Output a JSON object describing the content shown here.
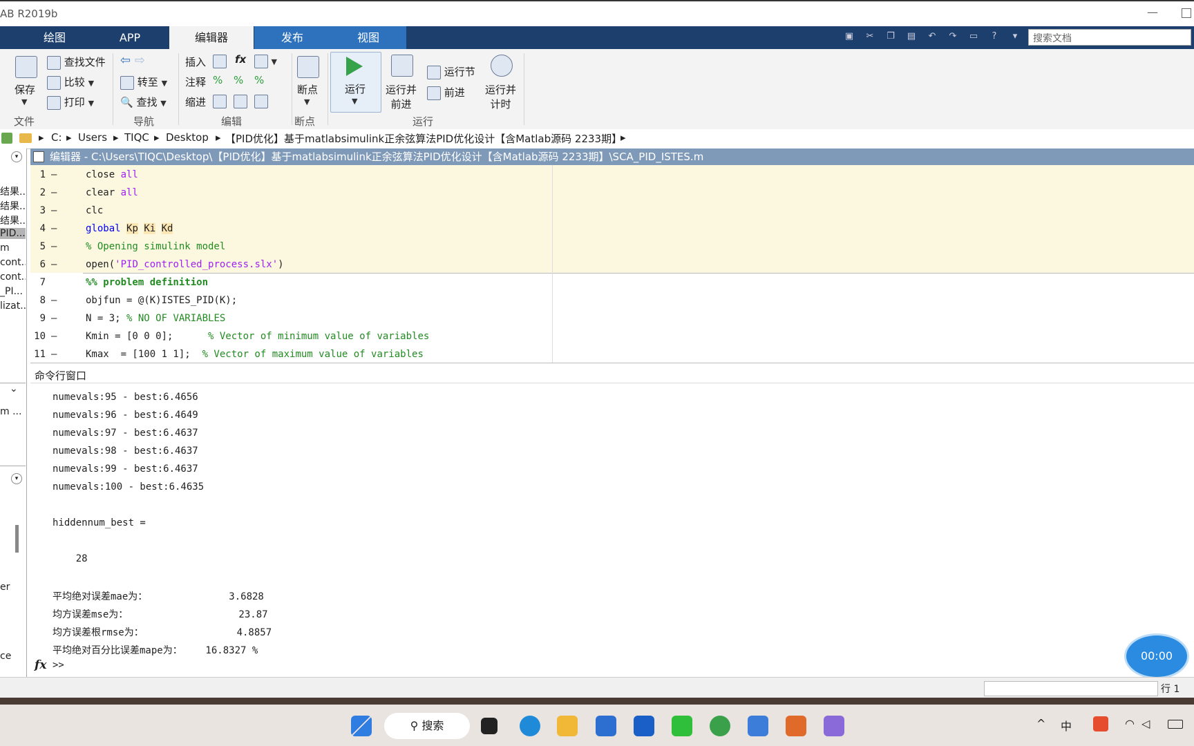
{
  "window": {
    "title": "AB R2019b"
  },
  "tabs": [
    {
      "label": "绘图"
    },
    {
      "label": "APP"
    },
    {
      "label": "编辑器"
    },
    {
      "label": "发布"
    },
    {
      "label": "视图"
    }
  ],
  "search": {
    "placeholder": "搜索文档"
  },
  "ribbon": {
    "file": {
      "save": "保存",
      "find_files": "查找文件",
      "compare": "比较",
      "print": "打印",
      "group": "文件"
    },
    "nav": {
      "goto": "转至",
      "find": "查找",
      "group": "导航"
    },
    "edit": {
      "insert": "插入",
      "comment": "注释",
      "indent": "缩进",
      "fx": "fx",
      "group": "编辑"
    },
    "breakpoint": {
      "label": "断点",
      "group": "断点"
    },
    "run": {
      "run": "运行",
      "run_advance_1": "运行并",
      "run_advance_2": "前进",
      "run_section": "运行节",
      "advance": "前进",
      "run_time_1": "运行并",
      "run_time_2": "计时",
      "group": "运行"
    }
  },
  "address": [
    "C:",
    "Users",
    "TIQC",
    "Desktop",
    "【PID优化】基于matlabsimulink正余弦算法PID优化设计【含Matlab源码 2233期】"
  ],
  "left_panel": [
    "结果...",
    "结果...",
    "结果...",
    "PID...",
    "m",
    "cont...",
    "cont...",
    "_PI...",
    "lizat...",
    "m ...",
    "er",
    "ce"
  ],
  "editor": {
    "title": "编辑器 - C:\\Users\\TIQC\\Desktop\\【PID优化】基于matlabsimulink正余弦算法PID优化设计【含Matlab源码 2233期】\\SCA_PID_ISTES.m",
    "lines": [
      {
        "n": "1",
        "a": "close ",
        "b": "all"
      },
      {
        "n": "2",
        "a": "clear ",
        "b": "all"
      },
      {
        "n": "3",
        "a": "clc",
        "b": ""
      },
      {
        "n": "4",
        "a": "global ",
        "v1": "Kp",
        "v2": "Ki",
        "v3": "Kd"
      },
      {
        "n": "5",
        "c": "% Opening simulink model"
      },
      {
        "n": "6",
        "a": "open(",
        "s": "'PID_controlled_process.slx'",
        "e": ")"
      },
      {
        "n": "7",
        "c": "%% problem definition"
      },
      {
        "n": "8",
        "a": "objfun = @(K)ISTES_PID(K);"
      },
      {
        "n": "9",
        "a": "N = 3; ",
        "c": "% NO OF VARIABLES"
      },
      {
        "n": "10",
        "a": "Kmin = [0 0 0];      ",
        "c": "% Vector of minimum value of variables"
      },
      {
        "n": "11",
        "a": "Kmax  = [100 1 1];  ",
        "c": "% Vector of maximum value of variables"
      }
    ]
  },
  "command": {
    "title": "命令行窗口",
    "output": [
      "numevals:95 - best:6.4656",
      "numevals:96 - best:6.4649",
      "numevals:97 - best:6.4637",
      "numevals:98 - best:6.4637",
      "numevals:99 - best:6.4637",
      "numevals:100 - best:6.4635",
      "hiddennum_best =",
      "    28",
      "平均绝对误差mae为：              3.6828",
      "均方误差mse为：                   23.87",
      "均方误差根rmse为：                4.8857",
      "平均绝对百分比误差mape为：    16.8327 %"
    ],
    "prompt": ">>",
    "fx": "fx"
  },
  "timer": "00:00",
  "status": {
    "row_label": "行 1"
  },
  "taskbar": {
    "search": "搜索"
  }
}
